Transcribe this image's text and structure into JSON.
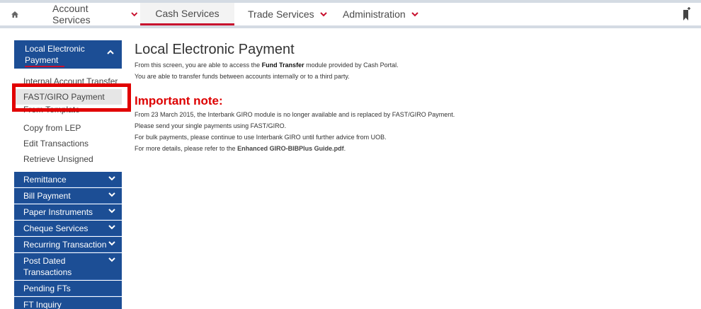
{
  "nav": {
    "items": [
      {
        "label": "Account Services",
        "dropdown": true,
        "active": false
      },
      {
        "label": "Cash Services",
        "dropdown": false,
        "active": true
      },
      {
        "label": "Trade Services",
        "dropdown": true,
        "active": false
      },
      {
        "label": "Administration",
        "dropdown": true,
        "active": false
      }
    ],
    "icons": {
      "home": "home-icon",
      "bookmark": "bookmark-icon"
    }
  },
  "sidebar": {
    "section": {
      "label": "Local Electronic Payment"
    },
    "subitems": [
      "Internal Account Transfer",
      "FAST/GIRO Payment",
      "From Template",
      "Copy from LEP",
      "Edit Transactions",
      "Retrieve Unsigned"
    ],
    "categories": [
      "Remittance",
      "Bill Payment",
      "Paper Instruments",
      "Cheque Services",
      "Recurring Transaction",
      "Post Dated Transactions",
      "Pending FTs",
      "FT Inquiry"
    ]
  },
  "main": {
    "title": "Local Electronic Payment",
    "intro1_pre": "From this screen, you are able to access the ",
    "intro1_bold": "Fund Transfer",
    "intro1_post": " module provided by Cash Portal.",
    "intro2": "You are able to transfer funds between accounts internally or to a third party.",
    "important_heading": "Important note:",
    "note1": "From 23 March 2015, the Interbank GIRO module is no longer available and is replaced by FAST/GIRO Payment.",
    "note2": "Please send your single payments using FAST/GIRO.",
    "note3": "For bulk payments, please continue to use Interbank GIRO until further advice from UOB.",
    "note4_pre": "For more details, please refer to the ",
    "note4_link": "Enhanced GIRO-BIBPlus Guide.pdf",
    "note4_post": "."
  },
  "colors": {
    "brand_blue": "#1c4e95",
    "accent_red": "#c8102e",
    "highlight_red": "#e10000"
  }
}
